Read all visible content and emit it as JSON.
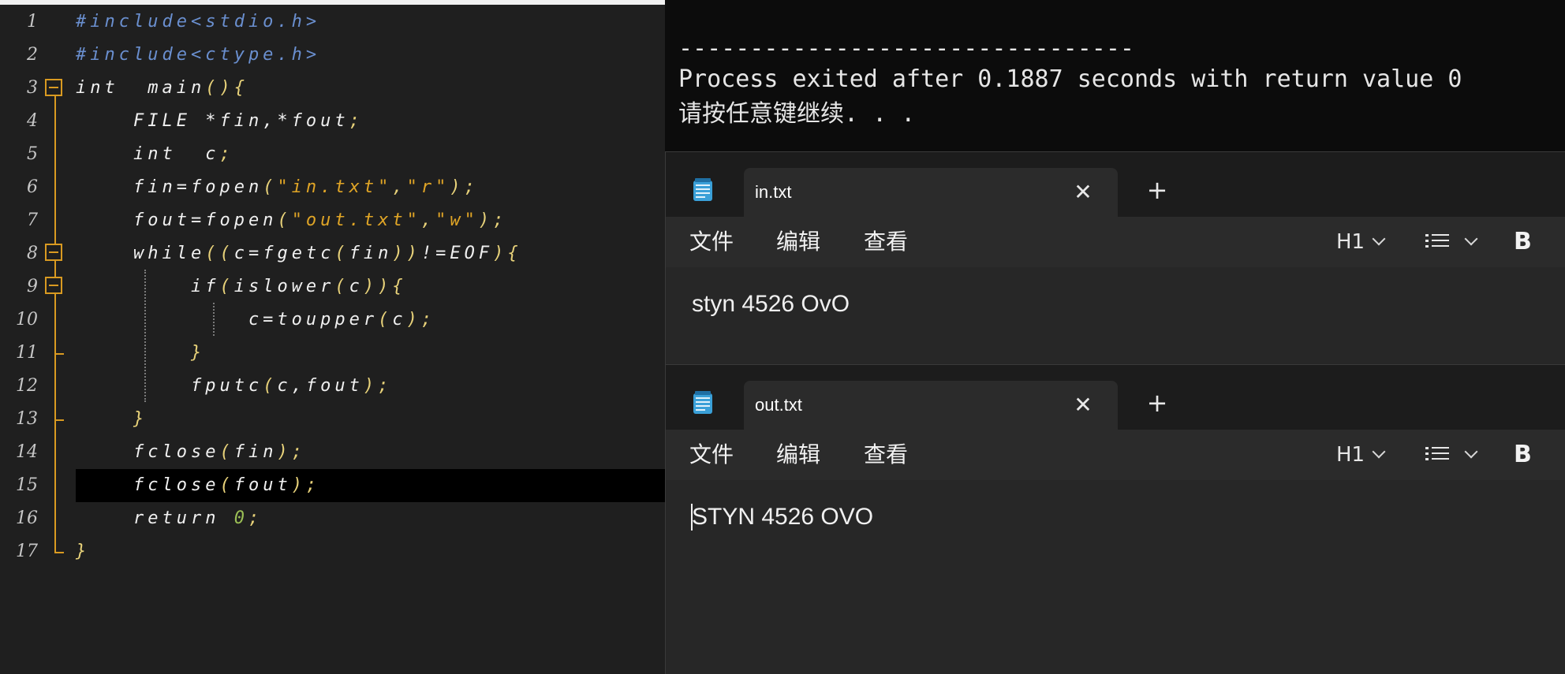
{
  "editor": {
    "lines": [
      {
        "no": "1",
        "segments": [
          [
            "pp",
            "#include<stdio.h>"
          ]
        ]
      },
      {
        "no": "2",
        "segments": [
          [
            "pp",
            "#include<ctype.h>"
          ]
        ]
      },
      {
        "no": "3",
        "segments": [
          [
            "kw",
            "int  main"
          ],
          [
            "pu",
            "(){"
          ]
        ]
      },
      {
        "no": "4",
        "segments": [
          [
            "kw",
            "    FILE *fin,*fout"
          ],
          [
            "pu",
            ";"
          ]
        ]
      },
      {
        "no": "5",
        "segments": [
          [
            "kw",
            "    int  c"
          ],
          [
            "pu",
            ";"
          ]
        ]
      },
      {
        "no": "6",
        "segments": [
          [
            "kw",
            "    fin=fopen"
          ],
          [
            "pu",
            "("
          ],
          [
            "str",
            "\"in.txt\""
          ],
          [
            "pu",
            ","
          ],
          [
            "str",
            "\"r\""
          ],
          [
            "pu",
            ");"
          ]
        ]
      },
      {
        "no": "7",
        "segments": [
          [
            "kw",
            "    fout=fopen"
          ],
          [
            "pu",
            "("
          ],
          [
            "str",
            "\"out.txt\""
          ],
          [
            "pu",
            ","
          ],
          [
            "str",
            "\"w\""
          ],
          [
            "pu",
            ");"
          ]
        ]
      },
      {
        "no": "8",
        "segments": [
          [
            "kw",
            "    while"
          ],
          [
            "pu",
            "(("
          ],
          [
            "kw",
            "c=fgetc"
          ],
          [
            "pu",
            "("
          ],
          [
            "kw",
            "fin"
          ],
          [
            "pu",
            "))"
          ],
          [
            "kw",
            "!=EOF"
          ],
          [
            "pu",
            "){"
          ]
        ]
      },
      {
        "no": "9",
        "segments": [
          [
            "kw",
            "        if"
          ],
          [
            "pu",
            "("
          ],
          [
            "kw",
            "islower"
          ],
          [
            "pu",
            "("
          ],
          [
            "kw",
            "c"
          ],
          [
            "pu",
            ")){"
          ]
        ]
      },
      {
        "no": "10",
        "segments": [
          [
            "kw",
            "            c=toupper"
          ],
          [
            "pu",
            "("
          ],
          [
            "kw",
            "c"
          ],
          [
            "pu",
            ");"
          ]
        ]
      },
      {
        "no": "11",
        "segments": [
          [
            "pu",
            "        }"
          ]
        ]
      },
      {
        "no": "12",
        "segments": [
          [
            "kw",
            "        fputc"
          ],
          [
            "pu",
            "("
          ],
          [
            "kw",
            "c,fout"
          ],
          [
            "pu",
            ");"
          ]
        ]
      },
      {
        "no": "13",
        "segments": [
          [
            "pu",
            "    }"
          ]
        ]
      },
      {
        "no": "14",
        "segments": [
          [
            "kw",
            "    fclose"
          ],
          [
            "pu",
            "("
          ],
          [
            "kw",
            "fin"
          ],
          [
            "pu",
            ");"
          ]
        ]
      },
      {
        "no": "15",
        "segments": [
          [
            "kw",
            "    fclose"
          ],
          [
            "pu",
            "("
          ],
          [
            "kw",
            "fout"
          ],
          [
            "pu",
            ");"
          ]
        ],
        "current": true
      },
      {
        "no": "16",
        "segments": [
          [
            "kw",
            "    return "
          ],
          [
            "num",
            "0"
          ],
          [
            "pu",
            ";"
          ]
        ]
      },
      {
        "no": "17",
        "segments": [
          [
            "pu",
            "}"
          ]
        ]
      }
    ]
  },
  "console": {
    "separator": "--------------------------------",
    "exit_message": "Process exited after 0.1887 seconds with return value 0",
    "press_key": "请按任意键继续. . ."
  },
  "notepads": [
    {
      "tab_title": "in.txt",
      "close_glyph": "✕",
      "new_tab_glyph": "+",
      "menu": [
        "文件",
        "编辑",
        "查看"
      ],
      "heading_select": "H1",
      "bold_label": "B",
      "content": "styn 4526 OvO"
    },
    {
      "tab_title": "out.txt",
      "close_glyph": "✕",
      "new_tab_glyph": "+",
      "menu": [
        "文件",
        "编辑",
        "查看"
      ],
      "heading_select": "H1",
      "bold_label": "B",
      "content": "STYN 4526 OVO"
    }
  ],
  "colors": {
    "editor_bg": "#1f1f1f",
    "fold_accent": "#d99a21",
    "string": "#e0a526",
    "preprocessor": "#6a8fcf",
    "console_bg": "#0c0c0c",
    "notepad_bg": "#2b2b2b"
  }
}
